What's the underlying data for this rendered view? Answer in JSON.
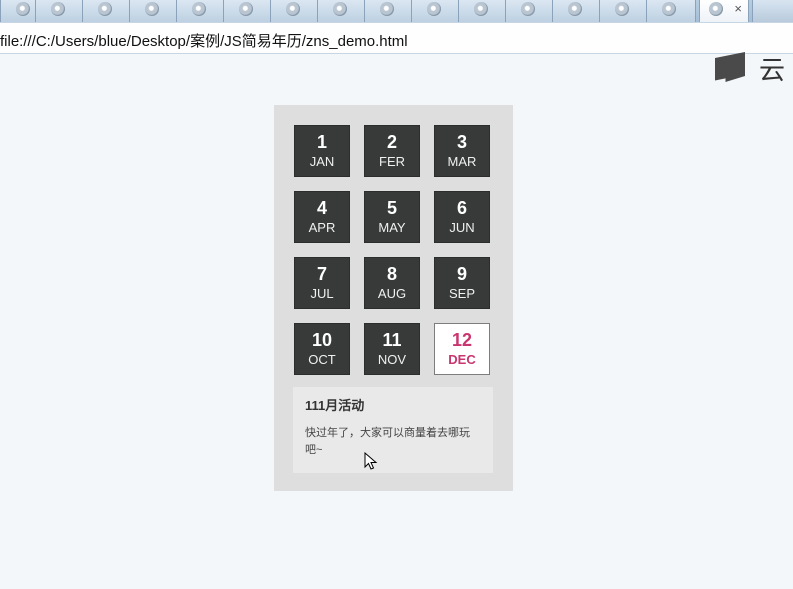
{
  "browser": {
    "url": "file:///C:/Users/blue/Desktop/案例/JS简易年历/zns_demo.html",
    "active_tab_close": "×"
  },
  "brand": {
    "text": "云"
  },
  "calendar": {
    "months": [
      {
        "num": "1",
        "abbr": "JAN"
      },
      {
        "num": "2",
        "abbr": "FER"
      },
      {
        "num": "3",
        "abbr": "MAR"
      },
      {
        "num": "4",
        "abbr": "APR"
      },
      {
        "num": "5",
        "abbr": "MAY"
      },
      {
        "num": "6",
        "abbr": "JUN"
      },
      {
        "num": "7",
        "abbr": "JUL"
      },
      {
        "num": "8",
        "abbr": "AUG"
      },
      {
        "num": "9",
        "abbr": "SEP"
      },
      {
        "num": "10",
        "abbr": "OCT"
      },
      {
        "num": "11",
        "abbr": "NOV"
      },
      {
        "num": "12",
        "abbr": "DEC"
      }
    ],
    "active_color": "#c9356f",
    "info": {
      "title": "111月活动",
      "desc": "快过年了，大家可以商量着去哪玩吧~"
    }
  }
}
